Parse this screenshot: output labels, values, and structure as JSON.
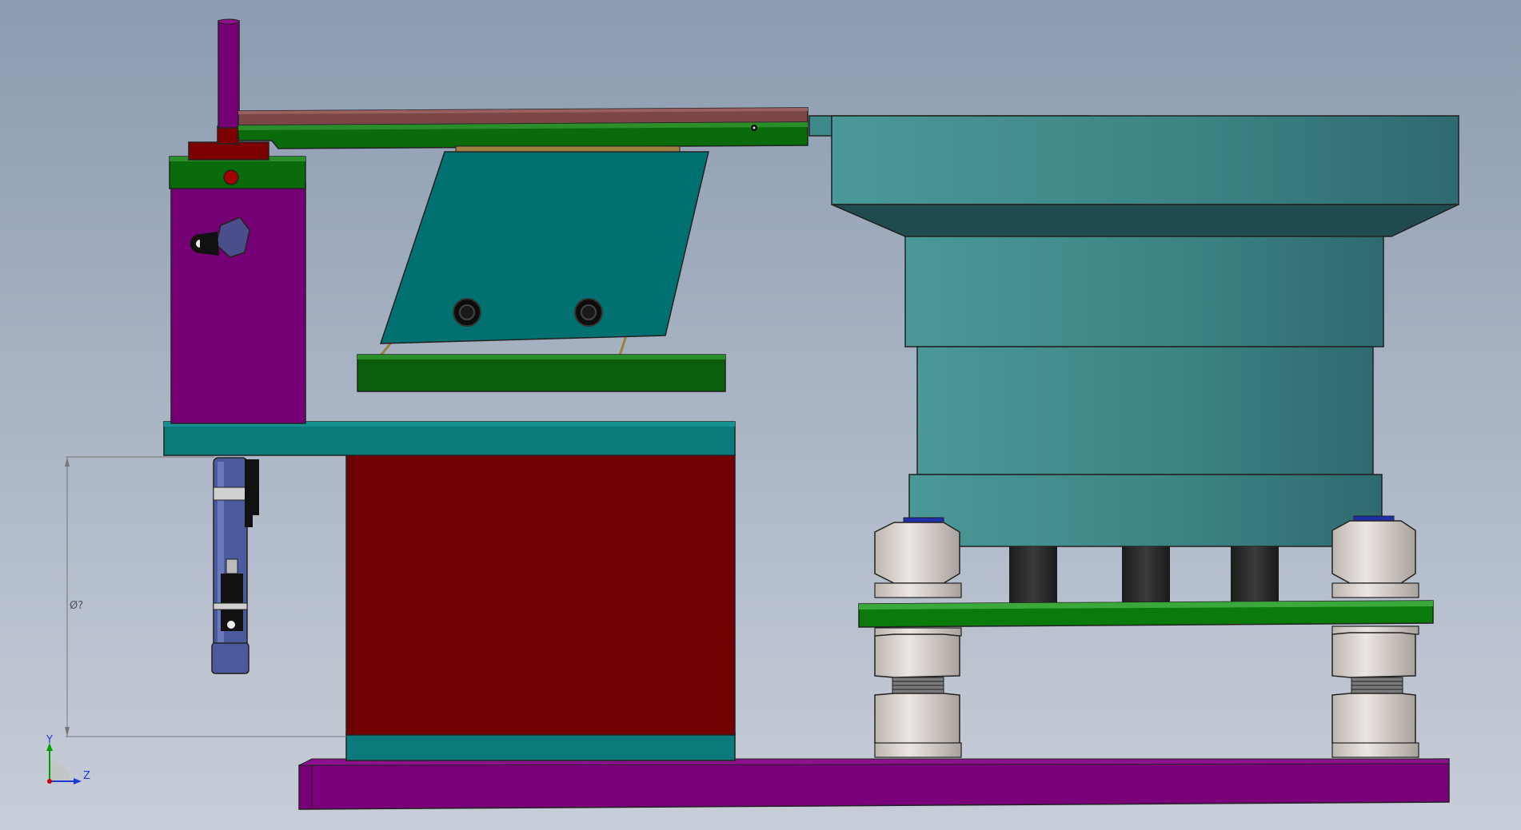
{
  "triad": {
    "y_label": "Y",
    "z_label": "Z"
  },
  "dimension": {
    "label": "Ø?"
  },
  "colors": {
    "purple": "#750075",
    "green": "#0a6b0a",
    "teal": "#0b7a7a",
    "red": "#750000",
    "steel": "#4a5a9c",
    "bowl": "#3f8c8c",
    "nut": "#d9d2cc"
  }
}
